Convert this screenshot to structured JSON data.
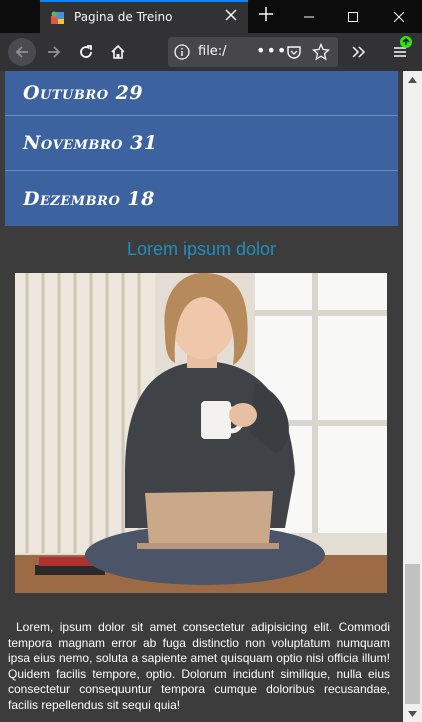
{
  "browser": {
    "tab_title": "Pagina de Treino",
    "url_text": "file:/",
    "url_more": "•••",
    "accent_color": "#0a84ff"
  },
  "icons": [
    "favicon-icon",
    "close-icon",
    "plus-icon",
    "minimize-icon",
    "maximize-icon",
    "window-close-icon",
    "back-arrow-icon",
    "forward-arrow-icon",
    "reload-icon",
    "home-icon",
    "info-icon",
    "pocket-icon",
    "star-icon",
    "overflow-chevrons-icon",
    "menu-icon",
    "update-badge-icon",
    "scroll-up-icon",
    "scroll-down-icon"
  ],
  "page": {
    "months": [
      {
        "label": "Outubro 29"
      },
      {
        "label": "Novembro 31"
      },
      {
        "label": "Dezembro 18"
      }
    ],
    "section_title": "Lorem ipsum dolor",
    "paragraph": "Lorem, ipsum dolor sit amet consectetur adipisicing elit. Commodi tempora magnam error ab fuga distinctio non voluptatum numquam ipsa eius nemo, soluta a sapiente amet quisquam optio nisi officia illum! Quidem facilis tempore, optio. Dolorum incidunt similique, nulla eius consectetur consequuntur tempora cumque doloribus recusandae, facilis repellendus sit sequi quia!",
    "colors": {
      "month_bg": "#3c63a0",
      "title": "#1f8fc0",
      "page_bg": "#3c3c3c"
    }
  }
}
